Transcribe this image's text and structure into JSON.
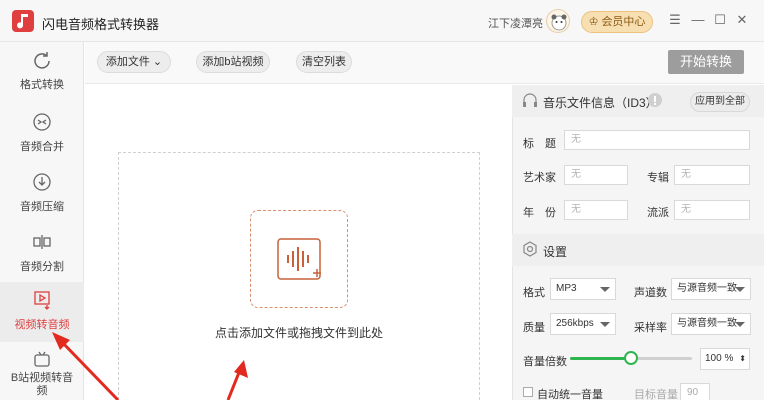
{
  "app": {
    "title": "闪电音频格式转换器",
    "username": "江下凌潭亮",
    "member_label": "会员中心"
  },
  "window": {
    "menu": "☰",
    "minimize": "—",
    "maximize": "☐",
    "close": "✕"
  },
  "sidebar": {
    "items": [
      {
        "label": "格式转换",
        "icon": "refresh-icon"
      },
      {
        "label": "音频合并",
        "icon": "merge-icon"
      },
      {
        "label": "音频压缩",
        "icon": "compress-icon"
      },
      {
        "label": "音频分割",
        "icon": "split-icon"
      },
      {
        "label": "视频转音频",
        "icon": "video-to-audio-icon",
        "active": true
      },
      {
        "label": "B站视频转音频",
        "icon": "bilibili-icon"
      }
    ]
  },
  "toolbar": {
    "add_file": "添加文件",
    "add_bilibili": "添加b站视频",
    "clear_list": "清空列表",
    "start": "开始转换"
  },
  "drop": {
    "hint": "点击添加文件或拖拽文件到此处"
  },
  "id3": {
    "title": "音乐文件信息（ID3）",
    "apply_all": "应用到全部",
    "fields": {
      "title_label": "标　题",
      "title_placeholder": "无",
      "artist_label": "艺术家",
      "artist_placeholder": "无",
      "album_label": "专辑",
      "album_placeholder": "无",
      "year_label": "年　份",
      "year_placeholder": "无",
      "genre_label": "流派",
      "genre_placeholder": "无"
    }
  },
  "settings": {
    "title": "设置",
    "format_label": "格式",
    "format_value": "MP3",
    "channels_label": "声道数",
    "channels_value": "与源音频一致",
    "quality_label": "质量",
    "quality_value": "256kbps",
    "samplerate_label": "采样率",
    "samplerate_value": "与源音频一致",
    "volume_label": "音量倍数",
    "volume_value": "100",
    "volume_unit": "%",
    "volume_level": 0.5,
    "auto_volume_label": "自动统一音量",
    "target_volume_label": "目标音量",
    "target_volume_value": "90"
  },
  "colors": {
    "accent": "#e03f3f",
    "slider": "#2fb550",
    "member": "#f8dfb2"
  }
}
